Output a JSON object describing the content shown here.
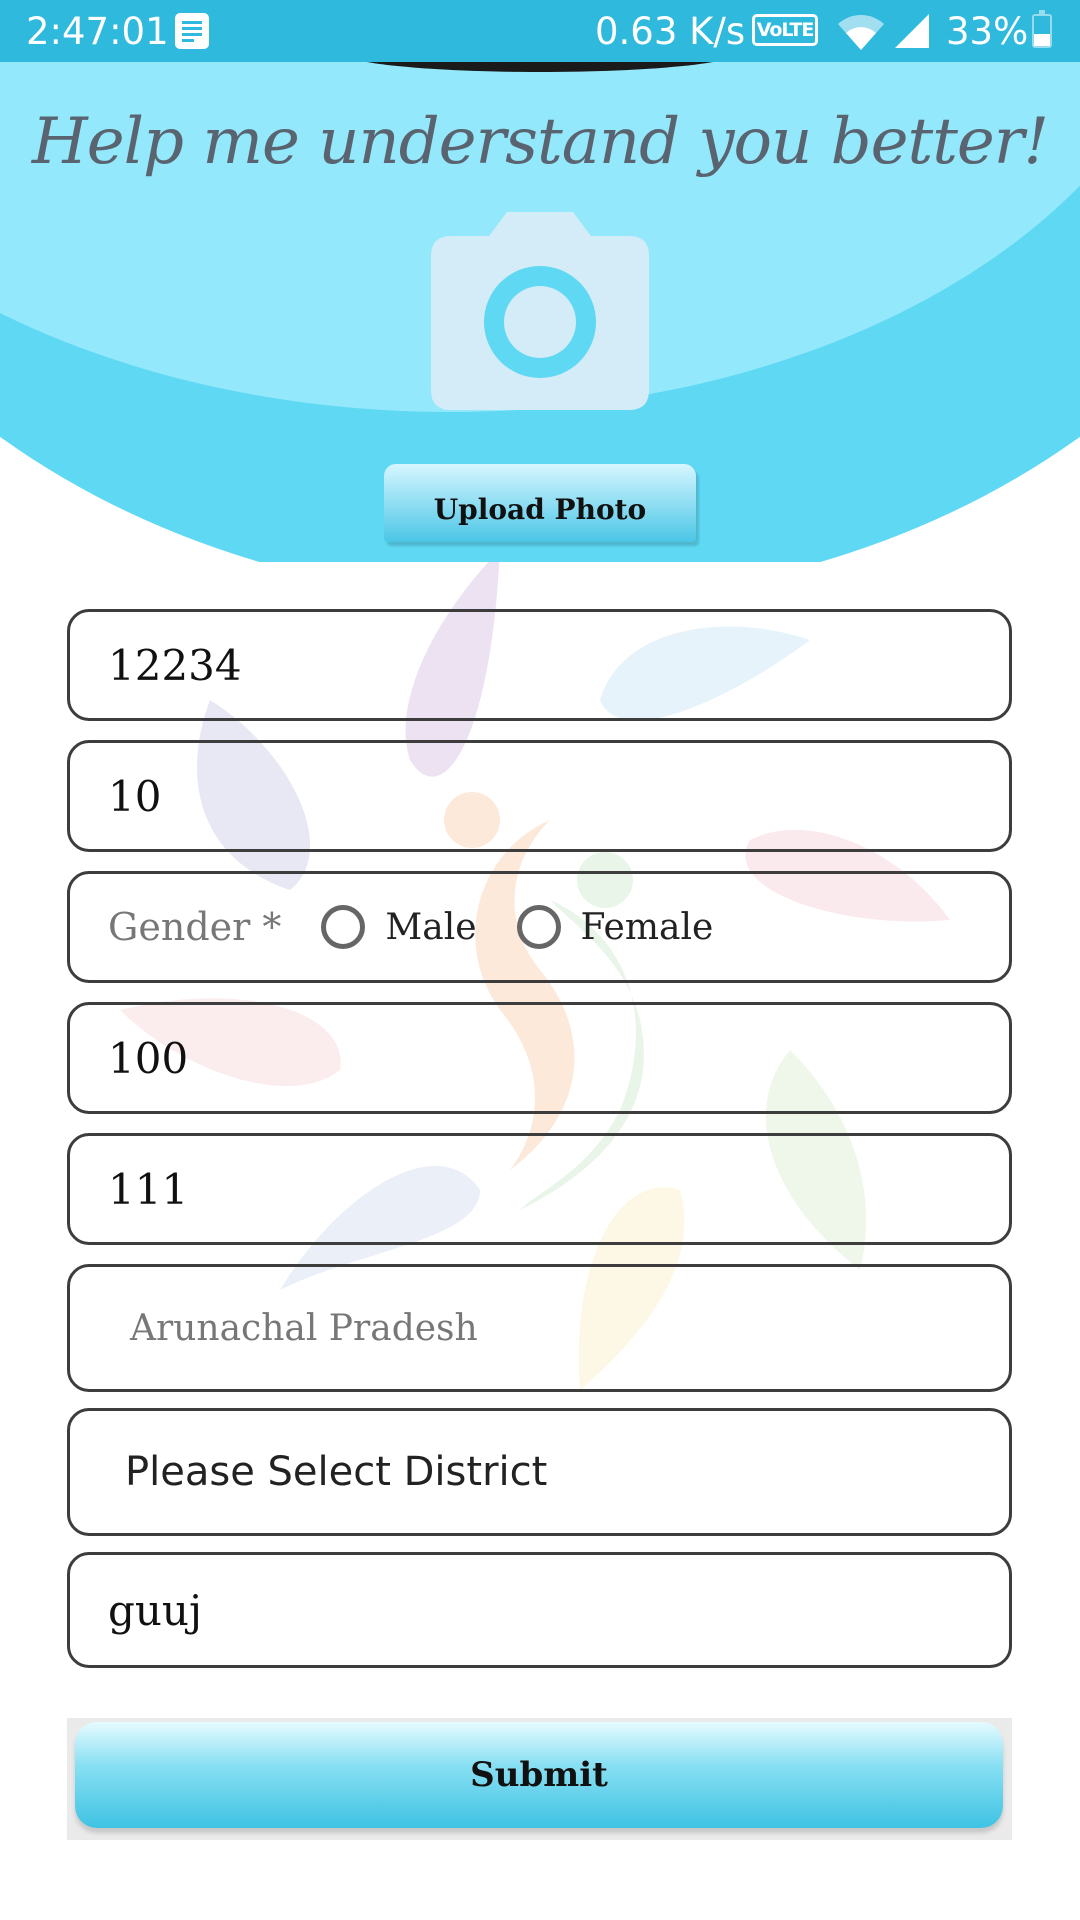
{
  "status_bar": {
    "time": "2:47:01",
    "network_speed": "0.63 K/s",
    "volte": "VoLTE",
    "battery": "33%"
  },
  "header": {
    "title": "Help me understand you better!",
    "upload_label": "Upload Photo"
  },
  "form": {
    "field1_value": "12234",
    "field2_value": "10",
    "gender_label": "Gender *",
    "gender_options": [
      "Male",
      "Female"
    ],
    "field4_value": "100",
    "field5_value": "111",
    "state_value": "Arunachal Pradesh",
    "district_value": "Please Select District",
    "field8_value": "guuj",
    "submit_label": "Submit"
  },
  "colors": {
    "status_bar": "#2fb9dd",
    "header_outer": "#5fd8f3",
    "header_inner": "#93e8fb",
    "button_accent": "#4bc6e6"
  }
}
